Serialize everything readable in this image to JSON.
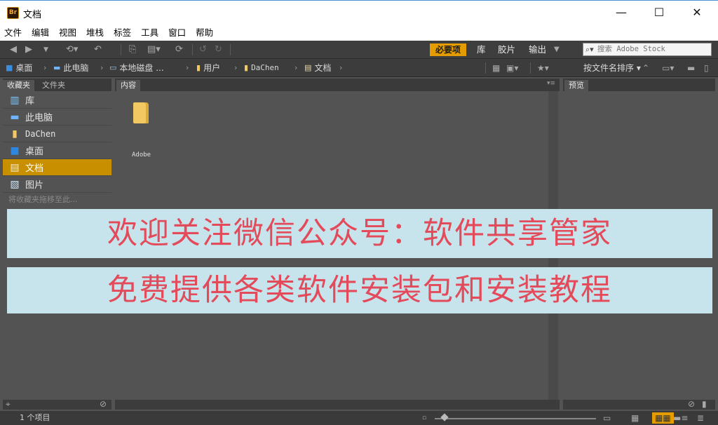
{
  "window": {
    "app_logo": "Br",
    "title": "文档",
    "controls": {
      "minimize": "—",
      "maximize": "☐",
      "close": "✕"
    }
  },
  "menu": [
    "文件",
    "编辑",
    "视图",
    "堆栈",
    "标签",
    "工具",
    "窗口",
    "帮助"
  ],
  "toolbar": {
    "workspaces": {
      "active": "必要项",
      "library": "库",
      "filmstrip": "胶片",
      "output": "输出"
    },
    "search_placeholder": "搜索 Adobe Stock",
    "icons": [
      "back-arrow-icon",
      "forward-arrow-icon",
      "recent-dropdown-icon",
      "boomerang-icon",
      "rotate-icon",
      "camera-import-icon",
      "copy-icon",
      "refresh-icon",
      "rotate-left-icon",
      "rotate-right-icon"
    ]
  },
  "pathbar": {
    "crumbs": [
      "桌面",
      "此电脑",
      "本地磁盘 ...",
      "用户",
      "DaChen",
      "文档"
    ],
    "sort_label": "按文件名排序"
  },
  "left_panel": {
    "tabs": [
      "收藏夹",
      "文件夹"
    ],
    "favorites": [
      {
        "label": "库",
        "icon": "library-icon"
      },
      {
        "label": "此电脑",
        "icon": "computer-icon"
      },
      {
        "label": "DaChen",
        "icon": "user-folder-icon"
      },
      {
        "label": "桌面",
        "icon": "desktop-icon"
      },
      {
        "label": "文档",
        "icon": "documents-icon",
        "selected": true
      },
      {
        "label": "图片",
        "icon": "pictures-icon"
      }
    ],
    "drop_hint": "将收藏夹拖移至此..."
  },
  "content_panel": {
    "tab": "内容",
    "items": [
      {
        "name": "Adobe",
        "type": "folder"
      }
    ]
  },
  "preview_panel": {
    "tab": "预览"
  },
  "status": {
    "item_count": "1 个项目"
  },
  "banners": {
    "line1": "欢迎关注微信公众号：软件共享管家",
    "line2": "免费提供各类软件安装包和安装教程"
  },
  "colors": {
    "accent": "#e59c00",
    "selected": "#c88f00",
    "panel_bg": "#535353",
    "banner_bg": "#c7e4ec",
    "banner_text": "#e34a5a"
  }
}
